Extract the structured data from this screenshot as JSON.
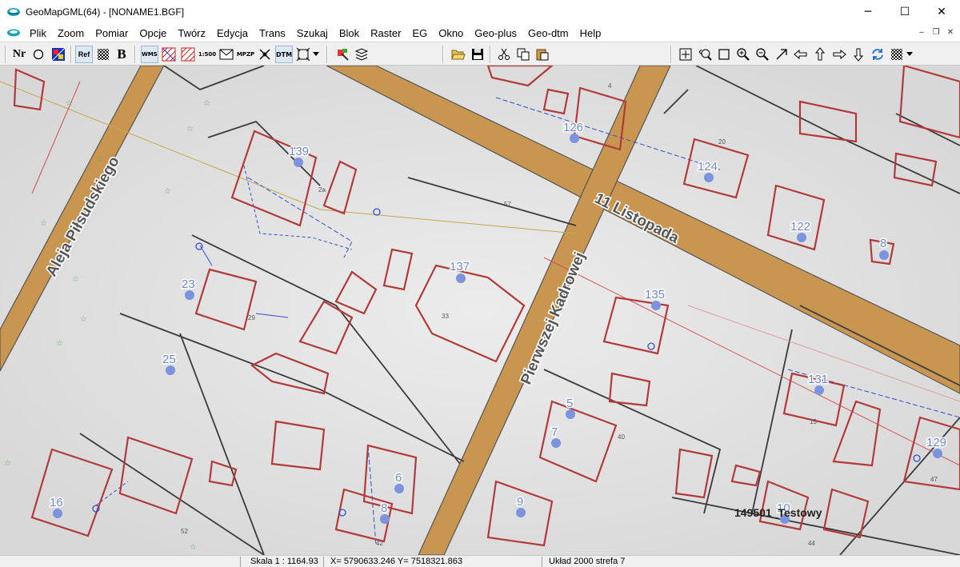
{
  "window": {
    "title": "GeoMapGML(64) - [NONAME1.BGF]",
    "minimize": "─",
    "maximize": "☐",
    "close": "✕"
  },
  "menu": [
    "Plik",
    "Zoom",
    "Pomiar",
    "Opcje",
    "Twórz",
    "Edycja",
    "Trans",
    "Szukaj",
    "Blok",
    "Raster",
    "EG",
    "Okno",
    "Geo-plus",
    "Geo-dtm",
    "Help"
  ],
  "mdi": {
    "minimize": "–",
    "restore": "❐",
    "close": "✕"
  },
  "toolbar": {
    "nr": "Nr",
    "ref": "Ref",
    "bold": "B",
    "wms": "WMS",
    "scale500": "1:500",
    "mpzp": "MPZP",
    "dtm": "DTM"
  },
  "map": {
    "streets": [
      {
        "id": "aleja",
        "text": "Aleja Piłsudskiego"
      },
      {
        "id": "listopada",
        "text": "11 Listopada"
      },
      {
        "id": "kadrowej",
        "text": "Pierwszej Kadrowej"
      }
    ],
    "plots": [
      "139",
      "126",
      "124",
      "122",
      "8",
      "137",
      "23",
      "135",
      "25",
      "131",
      "5",
      "7",
      "129",
      "6",
      "8",
      "16",
      "9",
      "10"
    ],
    "overlay_text": "149501_Testowy",
    "small_labels": [
      "2a",
      "20",
      "4",
      "57",
      "33",
      "29",
      "40",
      "47",
      "15",
      "42",
      "52",
      "44"
    ]
  },
  "status": {
    "scale": "Skala 1 : 1164.93",
    "coords": "X= 5790633.246  Y= 7518321.863",
    "system": "Układ 2000 strefa 7"
  },
  "colors": {
    "road": "#c89650",
    "building": "#b33a3a",
    "plot_dot": "#7c93dd",
    "boundary": "#3b3b3b",
    "utility_blue": "#3050d0"
  }
}
